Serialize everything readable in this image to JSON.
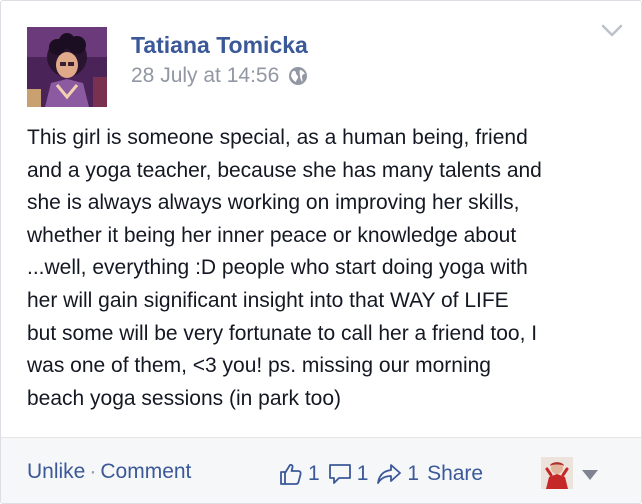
{
  "post": {
    "author": "Tatiana Tomicka",
    "timestamp": "28 July at 14:56",
    "privacy_icon": "globe-icon",
    "text": "This girl is someone special, as a human being, friend\nand a yoga teacher, because she has many talents and\nshe is always always working on improving her skills,\nwhether it being her inner peace or knowledge about\n...well, everything :D people who start doing yoga with\nher will gain significant insight into that WAY of LIFE\nbut some will be very fortunate to call her a friend too, I\nwas one of them, <3 you! ps. missing our morning\nbeach yoga sessions (in park too)"
  },
  "footer": {
    "unlike_label": "Unlike",
    "separator": "·",
    "comment_label": "Comment",
    "likes_count": "1",
    "comments_count": "1",
    "shares_count": "1",
    "share_label": "Share"
  },
  "colors": {
    "link": "#3b5998",
    "muted": "#9197a3",
    "text": "#141823",
    "footer_bg": "#f6f7f9"
  }
}
